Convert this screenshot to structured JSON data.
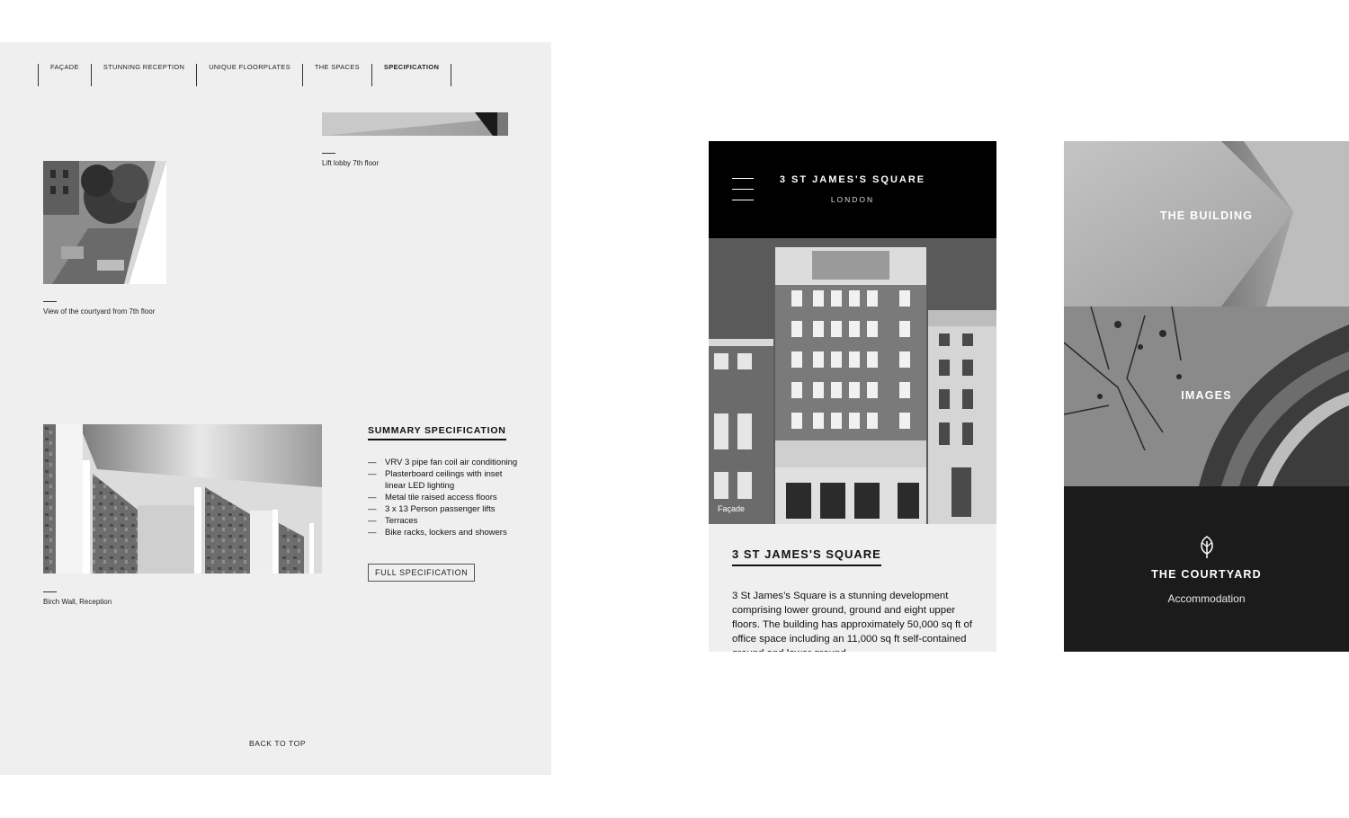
{
  "left": {
    "tabs": [
      {
        "label": "FAÇADE"
      },
      {
        "label": "STUNNING RECEPTION"
      },
      {
        "label": "UNIQUE FLOORPLATES"
      },
      {
        "label": "THE SPACES"
      },
      {
        "label": "SPECIFICATION"
      }
    ],
    "captions": {
      "lift_lobby": "Lift lobby 7th floor",
      "courtyard": "View of the courtyard from 7th floor",
      "birch": "Birch Wall, Reception"
    },
    "spec": {
      "title": "SUMMARY SPECIFICATION",
      "items": [
        "VRV 3 pipe fan coil air conditioning",
        "Plasterboard ceilings with inset linear LED lighting",
        "Metal tile raised access floors",
        "3 x 13 Person passenger lifts",
        "Terraces",
        "Bike racks, lockers and showers"
      ],
      "button": "FULL SPECIFICATION"
    },
    "back_to_top": "BACK TO TOP"
  },
  "mobile_home": {
    "title": "3 ST JAMES'S SQUARE",
    "subtitle": "LONDON",
    "hero_caption": "Façade",
    "heading": "3 ST JAMES'S SQUARE",
    "body": "3 St James’s Square is a stunning development comprising lower ground, ground and eight upper floors. The building has approximately 50,000 sq ft of office space including an 11,000 sq ft self-contained ground and lower ground"
  },
  "mobile_menu": {
    "items": [
      {
        "label": "THE BUILDING"
      },
      {
        "label": "IMAGES"
      },
      {
        "label": "THE COURTYARD",
        "sub": "Accommodation"
      }
    ]
  },
  "colors": {
    "black": "#000000",
    "panel_grey": "#efefef",
    "menu_dark": "#1b1b1b"
  }
}
